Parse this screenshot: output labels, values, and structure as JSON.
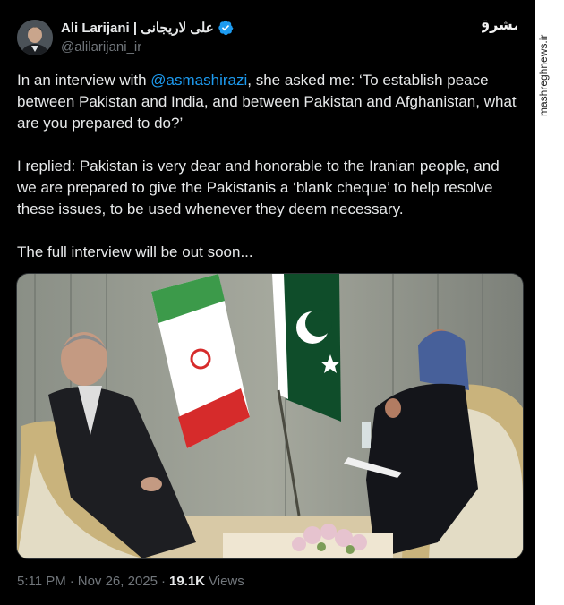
{
  "author": {
    "display_name": "Ali Larijani | علی لاریجانی",
    "handle": "@alilarijani_ir",
    "verified_icon": "verified-badge-icon"
  },
  "tweet": {
    "p1_before": "In an interview with ",
    "p1_mention": "@asmashirazi",
    "p1_after": ", she asked me: ‘To establish peace between Pakistan and India, and between Pakistan and Afghanistan, what are you prepared to do?’",
    "p2": "I replied: Pakistan is very dear and honorable to the Iranian people, and we are prepared to give the Pakistanis a ‘blank cheque’ to help resolve these issues, to be used whenever they deem necessary.",
    "p3": "The full interview will be out soon..."
  },
  "meta": {
    "time": "5:11 PM",
    "separator": "·",
    "date": "Nov 26, 2025",
    "views_count": "19.1K",
    "views_label": "Views"
  },
  "watermark": {
    "site": "mashreghnews.ir",
    "logo_text": "مشرق"
  },
  "colors": {
    "background": "#000000",
    "text": "#e7e9ea",
    "secondary": "#71767b",
    "link": "#1d9bf0"
  }
}
